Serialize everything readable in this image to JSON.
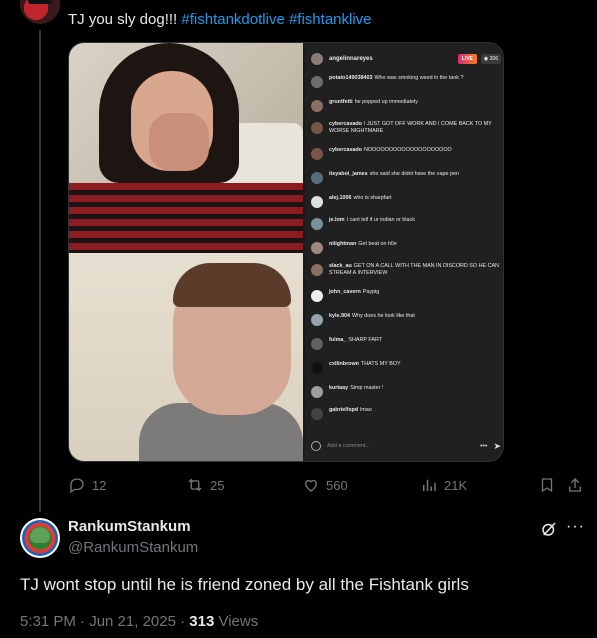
{
  "top_tweet": {
    "text_prefix": "TJ you sly dog!!!",
    "hashtags": [
      "#fishtankdotlive",
      "#fishtanklive"
    ]
  },
  "stream_chat": {
    "host_username": "angelinnareyes",
    "live_label": "LIVE",
    "viewer_count": "◉ 206",
    "comments": [
      {
        "user": "potato149038403",
        "text": "Who was smoking weed in the tank ?",
        "color": "#6d6d6d"
      },
      {
        "user": "gruntfetti",
        "text": "he popped up immediately",
        "color": "#8d6e63"
      },
      {
        "user": "cybercasado",
        "text": "I JUST GOT OFF WORK AND I COME BACK TO MY WORSE NIGHTMARE",
        "color": "#795548"
      },
      {
        "user": "cybercasado",
        "text": "NOOOOOOOOOOOOOOOOOOOO",
        "color": "#795548"
      },
      {
        "user": "itsyaboi_james",
        "text": "she said she didnt have the vape pen",
        "color": "#546e7a"
      },
      {
        "user": "alej.1006",
        "text": "who is sharpfart",
        "color": "#e0e0e0"
      },
      {
        "user": "je.lom",
        "text": "I cant tell if ur indian or black",
        "color": "#78909c"
      },
      {
        "user": "niiightman",
        "text": "Get beat on h0e",
        "color": "#a1887f"
      },
      {
        "user": "slack_au",
        "text": "GET ON A CALL WITH THE MAN IN DISCORD SO HE CAN STREAM A INTERVIEW",
        "color": "#8d6e63"
      },
      {
        "user": "john_cavern",
        "text": "Paypig",
        "color": "#eeeeee"
      },
      {
        "user": "kyle.904",
        "text": "Why does he look like that",
        "color": "#90a4ae"
      },
      {
        "user": "fulma_",
        "text": "SHARP FART",
        "color": "#616161"
      },
      {
        "user": "cxllinbrown",
        "text": "THATS MY BOY",
        "color": "#111111"
      },
      {
        "user": "kurtaay",
        "text": "Simp master !",
        "color": "#9e9e9e"
      },
      {
        "user": "gabrielfspd",
        "text": "lmao",
        "color": "#424242"
      }
    ],
    "input_placeholder": "Add a comment...",
    "more_glyph": "•••",
    "send_glyph": "➤"
  },
  "actions": {
    "replies": "12",
    "reposts": "25",
    "likes": "560",
    "views": "21K"
  },
  "reply": {
    "display_name": "RankumStankum",
    "handle": "@RankumStankum",
    "text": "TJ wont stop until he is friend zoned by all the Fishtank girls",
    "timestamp": "5:31 PM · Jun 21, 2025 · ",
    "views_count": "313",
    "views_label": " Views",
    "more_glyph": "···"
  },
  "colors": {
    "background": "#000000",
    "link": "#1d9bf0",
    "secondary_text": "#71767b",
    "primary_text": "#e7e9ea"
  }
}
